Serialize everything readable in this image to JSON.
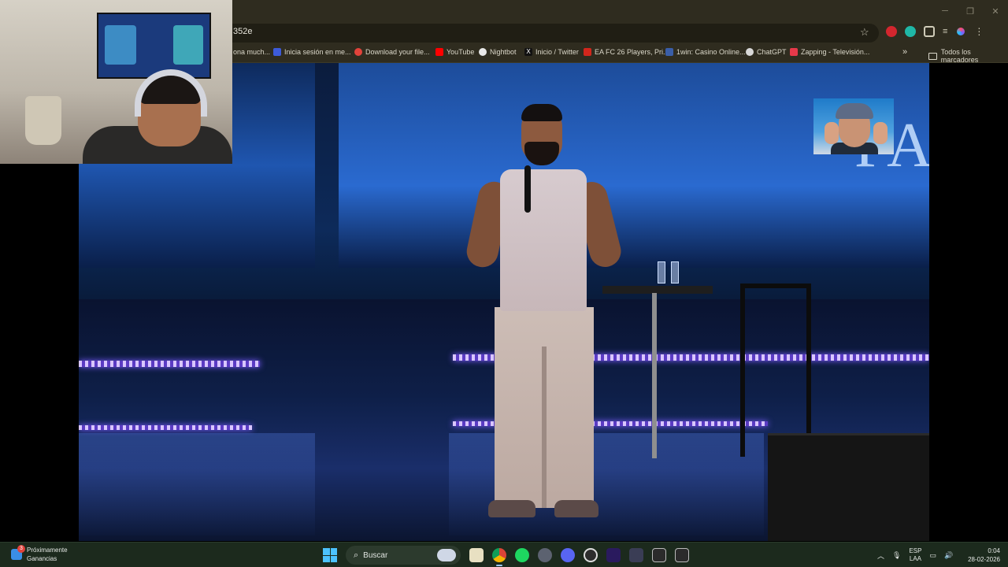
{
  "browser": {
    "url_fragment": "352e",
    "window_controls": [
      "─",
      "❐",
      "✕"
    ],
    "bookmarks": [
      {
        "label": "ona much...",
        "color": "#2f2c1f"
      },
      {
        "label": "Inicia sesión en me...",
        "color": "#3d5bd9"
      },
      {
        "label": "Download your file...",
        "color": "#e2433b"
      },
      {
        "label": "YouTube",
        "color": "#ff0000"
      },
      {
        "label": "Nightbot",
        "color": "#e8e8e8"
      },
      {
        "label": "Inicio / Twitter",
        "color": "#111111"
      },
      {
        "label": "EA FC 26 Players, Pri...",
        "color": "#d2261c"
      },
      {
        "label": "1win: Casino Online...",
        "color": "#3a5ea8"
      },
      {
        "label": "ChatGPT",
        "color": "#d8d8d8"
      },
      {
        "label": "Zapping - Televisión...",
        "color": "#e6394a"
      }
    ],
    "bookmarks_overflow": "»",
    "all_bookmarks": "Todos los marcadores"
  },
  "video": {
    "stage_logo": "PA"
  },
  "taskbar": {
    "widget": {
      "title": "Próximamente",
      "subtitle": "Ganancias",
      "badge": "3"
    },
    "search_placeholder": "Buscar",
    "apps": [
      {
        "name": "file-explorer",
        "color": "#e8e0c2",
        "active": false
      },
      {
        "name": "chrome",
        "color": "#e0b13b",
        "active": true
      },
      {
        "name": "spotify",
        "color": "#1ed760",
        "active": false
      },
      {
        "name": "app-circle",
        "color": "#5c6270",
        "active": false
      },
      {
        "name": "discord",
        "color": "#5865f2",
        "active": false
      },
      {
        "name": "obs",
        "color": "#2d2d2d",
        "active": false
      },
      {
        "name": "premiere",
        "color": "#2a1a5e",
        "active": false
      },
      {
        "name": "affinity",
        "color": "#3a3d55",
        "active": false
      },
      {
        "name": "app-m1",
        "color": "#2b2b2b",
        "active": false
      },
      {
        "name": "app-m2",
        "color": "#2b2b2b",
        "active": false
      }
    ],
    "language": {
      "line1": "ESP",
      "line2": "LAA"
    },
    "time": "0:04",
    "date": "28-02-2026"
  },
  "colors": {
    "chrome_bg": "#2f2c1f",
    "taskbar_bg": "#1c2a1d",
    "stage_blue": "#2a6ad0"
  }
}
